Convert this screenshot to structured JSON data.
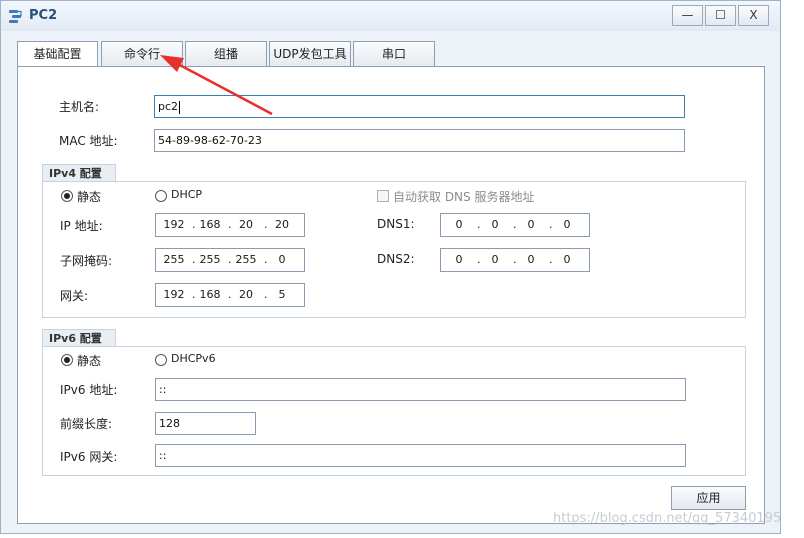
{
  "window": {
    "title": "PC2",
    "controls": {
      "minimize": "—",
      "maximize": "☐",
      "close": "X"
    }
  },
  "tabs": [
    {
      "label": "基础配置"
    },
    {
      "label": "命令行"
    },
    {
      "label": "组播"
    },
    {
      "label": "UDP发包工具"
    },
    {
      "label": "串口"
    }
  ],
  "basic": {
    "hostname_label": "主机名:",
    "hostname_value": "pc2",
    "mac_label": "MAC 地址:",
    "mac_value": "54-89-98-62-70-23"
  },
  "ipv4": {
    "section_title": "IPv4 配置",
    "static_label": "静态",
    "dhcp_label": "DHCP",
    "dns_auto_label": "自动获取 DNS 服务器地址",
    "ip_label": "IP 地址:",
    "ip": [
      "192",
      "168",
      "20",
      "20"
    ],
    "mask_label": "子网掩码:",
    "mask": [
      "255",
      "255",
      "255",
      "0"
    ],
    "gateway_label": "网关:",
    "gateway": [
      "192",
      "168",
      "20",
      "5"
    ],
    "dns1_label": "DNS1:",
    "dns1": [
      "0",
      "0",
      "0",
      "0"
    ],
    "dns2_label": "DNS2:",
    "dns2": [
      "0",
      "0",
      "0",
      "0"
    ]
  },
  "ipv6": {
    "section_title": "IPv6 配置",
    "static_label": "静态",
    "dhcp_label": "DHCPv6",
    "ip_label": "IPv6 地址:",
    "ip_value": "::",
    "prefix_label": "前缀长度:",
    "prefix_value": "128",
    "gateway_label": "IPv6 网关:",
    "gateway_value": "::"
  },
  "apply_label": "应用",
  "watermark": "https://blog.csdn.net/qq_57340195",
  "colors": {
    "annotation_arrow": "#e8302a",
    "title_text": "#2b4e7a"
  }
}
